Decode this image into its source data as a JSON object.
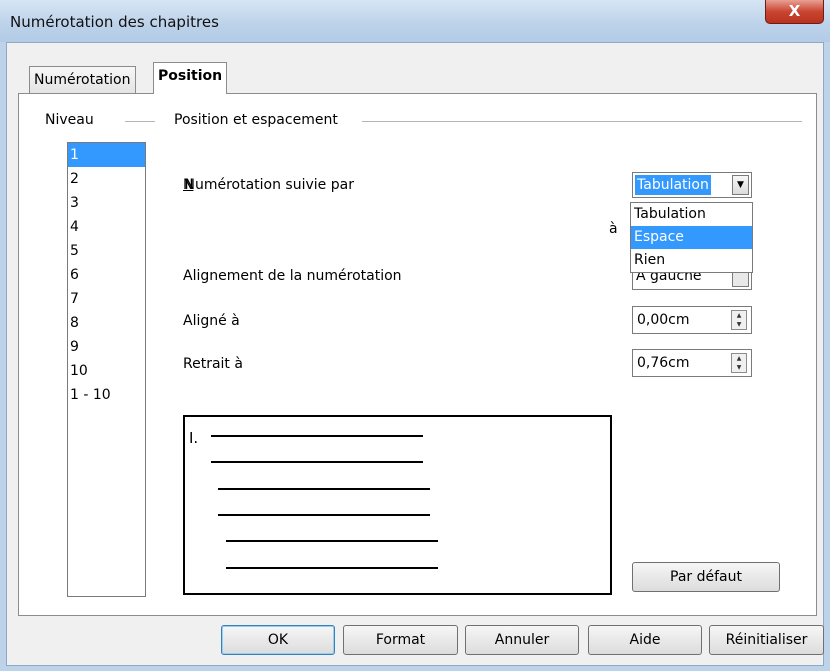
{
  "window": {
    "title": "Numérotation des chapitres",
    "close_glyph": "X"
  },
  "tabs": [
    {
      "label": "Numérotation",
      "active": false
    },
    {
      "label": "Position",
      "active": true
    }
  ],
  "niveau": {
    "label": "Niveau",
    "items": [
      "1",
      "2",
      "3",
      "4",
      "5",
      "6",
      "7",
      "8",
      "9",
      "10",
      "1 - 10"
    ],
    "selected": "1"
  },
  "position": {
    "group_label": "Position et espacement",
    "followed_by_label": "Numérotation suivie par",
    "followed_by_value": "Tabulation",
    "followed_by_options": [
      "Tabulation",
      "Espace",
      "Rien"
    ],
    "highlighted_option": "Espace",
    "at_label": "à",
    "alignment_label": "Alignement de la numérotation",
    "alignment_value": "A gauche",
    "aligned_at_label": "Aligné à",
    "aligned_at_value": "0,00cm",
    "indent_at_label": "Retrait à",
    "indent_at_value": "0,76cm"
  },
  "preview": {
    "number": "I."
  },
  "buttons": {
    "default": "Par défaut",
    "ok": "OK",
    "format": "Format",
    "cancel": "Annuler",
    "help": "Aide",
    "reset": "Réinitialiser"
  }
}
